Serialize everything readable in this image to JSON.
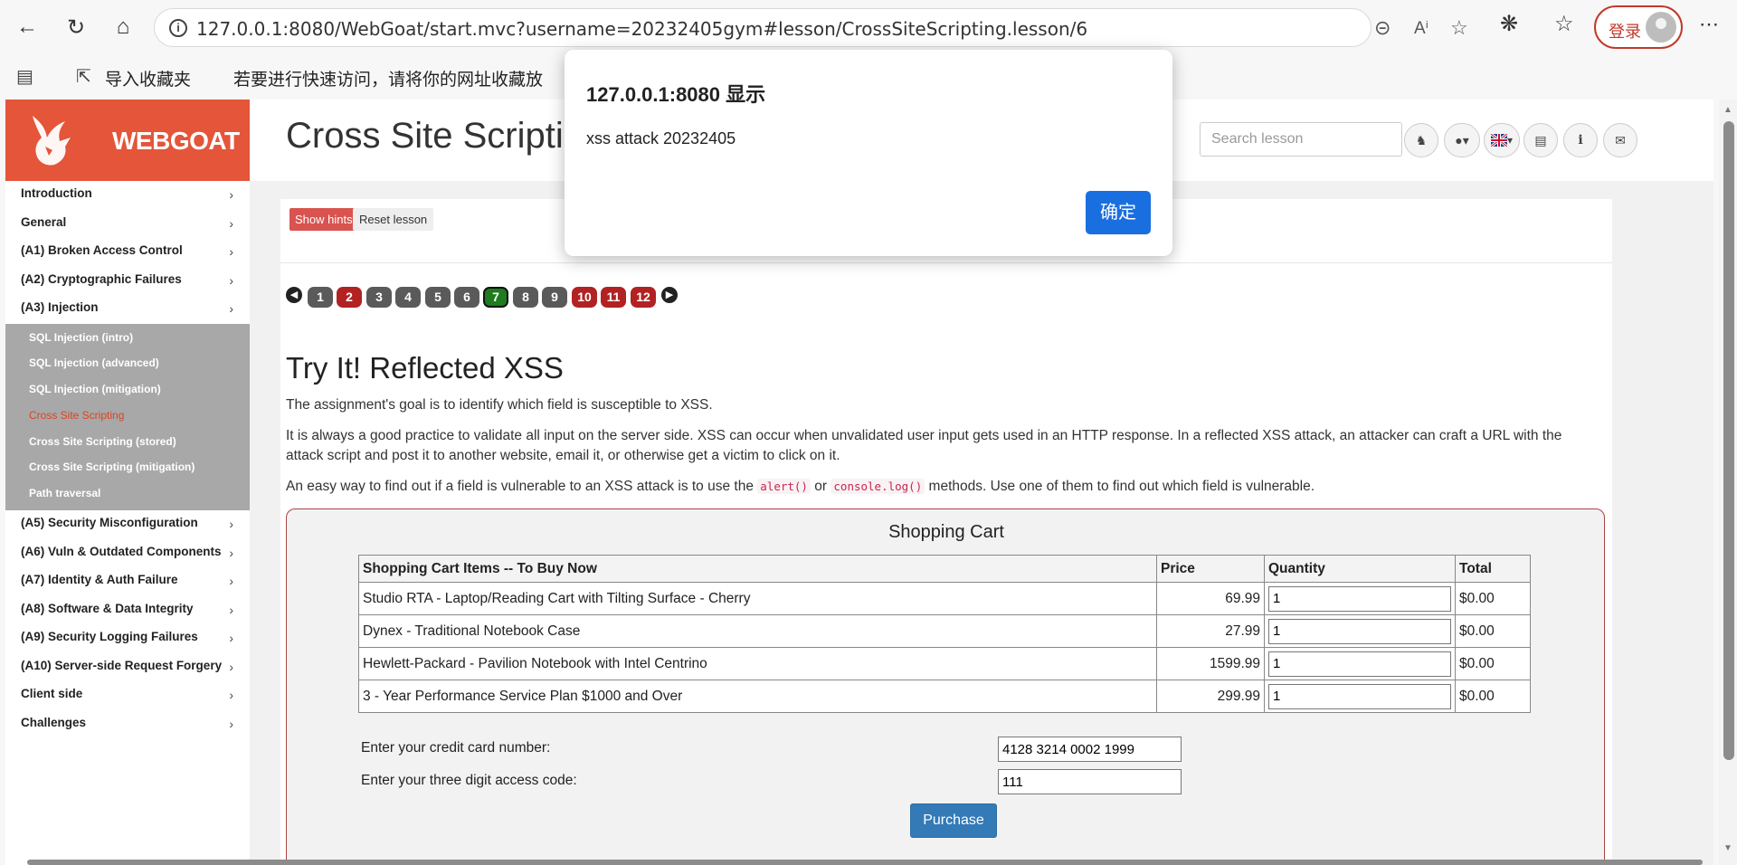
{
  "browser": {
    "url": "127.0.0.1:8080/WebGoat/start.mvc?username=20232405gym#lesson/CrossSiteScripting.lesson/6",
    "login_label": "登录",
    "bookmarks": {
      "import": "导入收藏夹",
      "hint": "若要进行快速访问，请将你的网址收藏放"
    }
  },
  "logo": {
    "text": "WEBGOAT"
  },
  "sidebar": {
    "items": [
      {
        "label": "Introduction"
      },
      {
        "label": "General"
      },
      {
        "label": "(A1) Broken Access Control"
      },
      {
        "label": "(A2) Cryptographic Failures"
      },
      {
        "label": "(A3) Injection"
      }
    ],
    "subitems": [
      {
        "label": "SQL Injection (intro)"
      },
      {
        "label": "SQL Injection (advanced)"
      },
      {
        "label": "SQL Injection (mitigation)"
      },
      {
        "label": "Cross Site Scripting"
      },
      {
        "label": "Cross Site Scripting (stored)"
      },
      {
        "label": "Cross Site Scripting (mitigation)"
      },
      {
        "label": "Path traversal"
      }
    ],
    "items2": [
      {
        "label": "(A5) Security Misconfiguration"
      },
      {
        "label": "(A6) Vuln & Outdated Components"
      },
      {
        "label": "(A7) Identity & Auth Failure"
      },
      {
        "label": "(A8) Software & Data Integrity"
      },
      {
        "label": "(A9) Security Logging Failures"
      },
      {
        "label": "(A10) Server-side Request Forgery"
      },
      {
        "label": "Client side"
      },
      {
        "label": "Challenges"
      }
    ]
  },
  "header": {
    "title": "Cross Site Scripting",
    "search_placeholder": "Search lesson"
  },
  "lesson": {
    "show_hints": "Show hints",
    "reset": "Reset lesson",
    "pages": [
      "1",
      "2",
      "3",
      "4",
      "5",
      "6",
      "7",
      "8",
      "9",
      "10",
      "11",
      "12"
    ],
    "heading": "Try It! Reflected XSS",
    "p1": "The assignment's goal is to identify which field is susceptible to XSS.",
    "p2": "It is always a good practice to validate all input on the server side. XSS can occur when unvalidated user input gets used in an HTTP response. In a reflected XSS attack, an attacker can craft a URL with the attack script and post it to another website, email it, or otherwise get a victim to click on it.",
    "p3a": "An easy way to find out if a field is vulnerable to an XSS attack is to use the",
    "code1": "alert()",
    "p3b": "or",
    "code2": "console.log()",
    "p3c": "methods. Use one of them to find out which field is vulnerable."
  },
  "cart": {
    "caption": "Shopping Cart",
    "headers": [
      "Shopping Cart Items -- To Buy Now",
      "Price",
      "Quantity",
      "Total"
    ],
    "rows": [
      {
        "item": "Studio RTA - Laptop/Reading Cart with Tilting Surface - Cherry",
        "price": "69.99",
        "qty": "1",
        "total": "$0.00"
      },
      {
        "item": "Dynex - Traditional Notebook Case",
        "price": "27.99",
        "qty": "1",
        "total": "$0.00"
      },
      {
        "item": "Hewlett-Packard - Pavilion Notebook with Intel Centrino",
        "price": "1599.99",
        "qty": "1",
        "total": "$0.00"
      },
      {
        "item": "3 - Year Performance Service Plan $1000 and Over",
        "price": "299.99",
        "qty": "1",
        "total": "$0.00"
      }
    ],
    "cc_label": "Enter your credit card number:",
    "cc_value": "4128 3214 0002 1999",
    "code_label": "Enter your three digit access code:",
    "code_value": "111",
    "purchase": "Purchase"
  },
  "dialog": {
    "title": "127.0.0.1:8080 显示",
    "message": "xss attack 20232405",
    "ok": "确定"
  }
}
